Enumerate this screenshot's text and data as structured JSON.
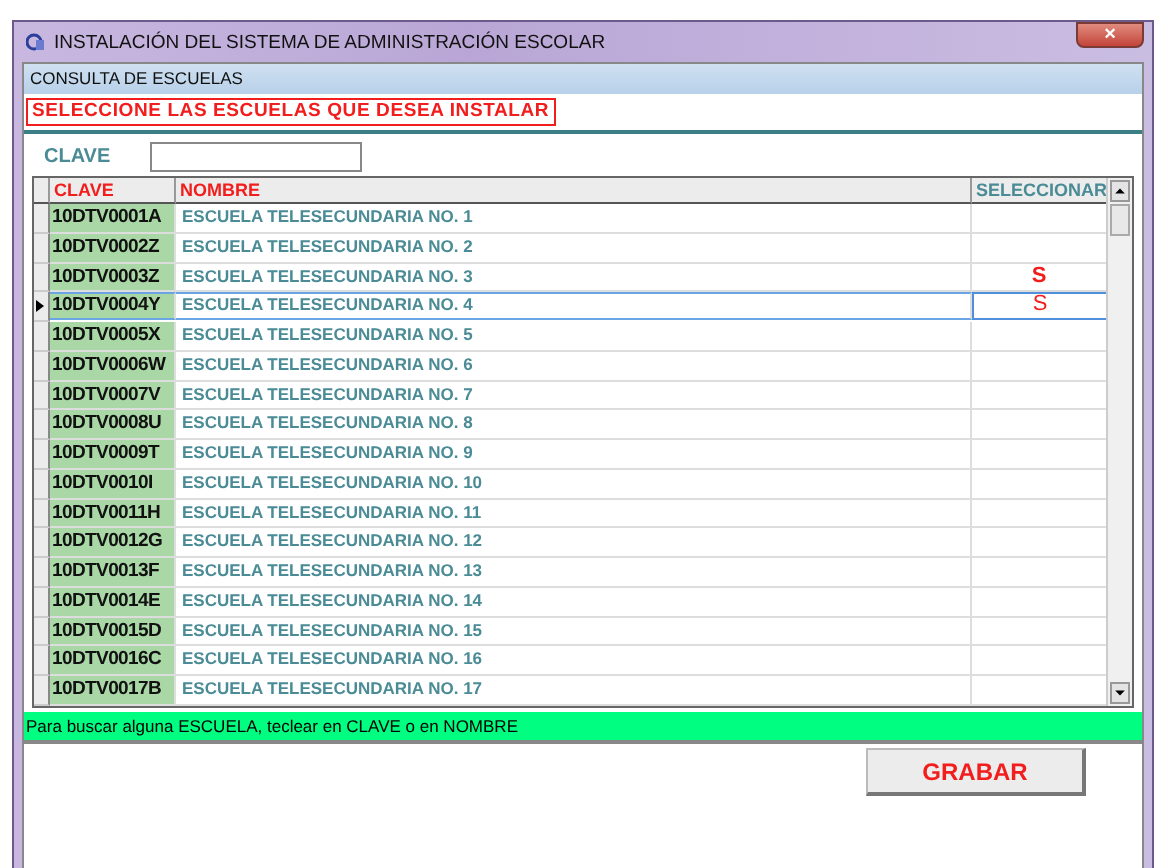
{
  "window": {
    "title": "INSTALACIÓN DEL  SISTEMA DE ADMINISTRACIÓN ESCOLAR",
    "close": "×"
  },
  "section_title": "CONSULTA DE ESCUELAS",
  "instruction": "SELECCIONE LAS ESCUELAS QUE DESEA INSTALAR",
  "search": {
    "label": "CLAVE"
  },
  "table": {
    "columns": [
      "CLAVE",
      "NOMBRE",
      "SELECCIONAR"
    ],
    "rows": [
      {
        "clave": "10DTV0001A",
        "nombre": "ESCUELA TELESECUNDARIA NO. 1",
        "current": false
      },
      {
        "clave": "10DTV0002Z",
        "nombre": "ESCUELA TELESECUNDARIA NO. 2",
        "current": false
      },
      {
        "clave": "10DTV0003Z",
        "nombre": "ESCUELA TELESECUNDARIA NO. 3",
        "seleccionar": "S",
        "current": false
      },
      {
        "clave": "10DTV0004Y",
        "nombre": "ESCUELA TELESECUNDARIA NO. 4",
        "seleccionar": "S",
        "current": true
      },
      {
        "clave": "10DTV0005X",
        "nombre": "ESCUELA TELESECUNDARIA NO. 5",
        "current": false
      },
      {
        "clave": "10DTV0006W",
        "nombre": "ESCUELA TELESECUNDARIA NO. 6",
        "current": false
      },
      {
        "clave": "10DTV0007V",
        "nombre": "ESCUELA TELESECUNDARIA NO. 7",
        "current": false
      },
      {
        "clave": "10DTV0008U",
        "nombre": "ESCUELA TELESECUNDARIA NO. 8",
        "current": false
      },
      {
        "clave": "10DTV0009T",
        "nombre": "ESCUELA TELESECUNDARIA NO. 9",
        "current": false
      },
      {
        "clave": "10DTV0010I",
        "nombre": "ESCUELA TELESECUNDARIA NO. 10",
        "current": false
      },
      {
        "clave": "10DTV0011H",
        "nombre": "ESCUELA TELESECUNDARIA NO. 11",
        "current": false
      },
      {
        "clave": "10DTV0012G",
        "nombre": "ESCUELA TELESECUNDARIA NO. 12",
        "current": false
      },
      {
        "clave": "10DTV0013F",
        "nombre": "ESCUELA TELESECUNDARIA NO. 13",
        "current": false
      },
      {
        "clave": "10DTV0014E",
        "nombre": "ESCUELA TELESECUNDARIA NO. 14",
        "current": false
      },
      {
        "clave": "10DTV0015D",
        "nombre": "ESCUELA TELESECUNDARIA NO. 15",
        "current": false
      },
      {
        "clave": "10DTV0016C",
        "nombre": "ESCUELA TELESECUNDARIA NO. 16",
        "current": false
      },
      {
        "clave": "10DTV0017B",
        "nombre": "ESCUELA TELESECUNDARIA NO. 17",
        "current": false
      }
    ]
  },
  "status_bar": "Para buscar alguna ESCUELA, teclear en CLAVE o en NOMBRE",
  "buttons": [
    "GRABAR"
  ]
}
